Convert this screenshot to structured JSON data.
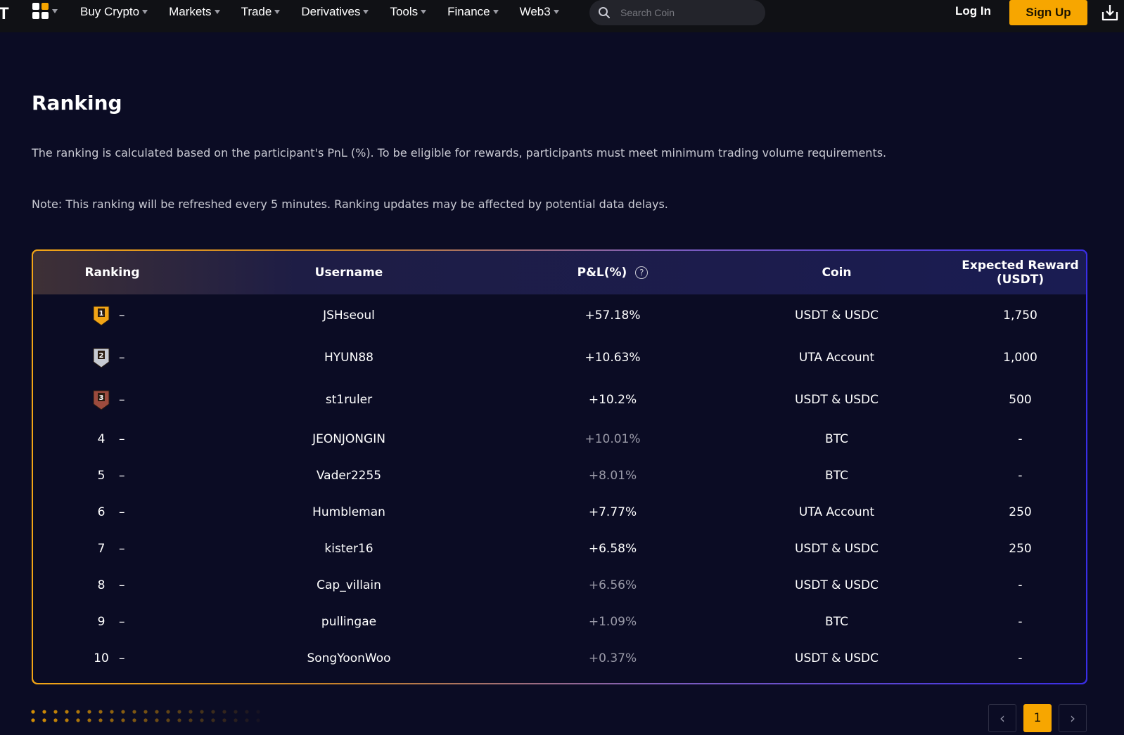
{
  "nav": {
    "logo_letter": "T",
    "items": [
      "Buy Crypto",
      "Markets",
      "Trade",
      "Derivatives",
      "Tools",
      "Finance",
      "Web3"
    ],
    "search_placeholder": "Search Coin",
    "login": "Log In",
    "signup": "Sign Up"
  },
  "page": {
    "title": "Ranking",
    "description": "The ranking is calculated based on the participant's PnL (%). To be eligible for rewards, participants must meet minimum trading volume requirements.",
    "note": "Note: This ranking will be refreshed every 5 minutes. Ranking updates may be affected by potential data delays."
  },
  "table": {
    "headers": {
      "ranking": "Ranking",
      "username": "Username",
      "pnl": "P&L(%)",
      "coin": "Coin",
      "reward": "Expected Reward (USDT)"
    },
    "rows": [
      {
        "rank": "1",
        "change": "–",
        "username": "JSHseoul",
        "pnl": "+57.18%",
        "coin": "USDT & USDC",
        "reward": "1,750"
      },
      {
        "rank": "2",
        "change": "–",
        "username": "HYUN88",
        "pnl": "+10.63%",
        "coin": "UTA Account",
        "reward": "1,000"
      },
      {
        "rank": "3",
        "change": "–",
        "username": "st1ruler",
        "pnl": "+10.2%",
        "coin": "USDT & USDC",
        "reward": "500"
      },
      {
        "rank": "4",
        "change": "–",
        "username": "JEONJONGIN",
        "pnl": "+10.01%",
        "coin": "BTC",
        "reward": "-"
      },
      {
        "rank": "5",
        "change": "–",
        "username": "Vader2255",
        "pnl": "+8.01%",
        "coin": "BTC",
        "reward": "-"
      },
      {
        "rank": "6",
        "change": "–",
        "username": "Humbleman",
        "pnl": "+7.77%",
        "coin": "UTA Account",
        "reward": "250"
      },
      {
        "rank": "7",
        "change": "–",
        "username": "kister16",
        "pnl": "+6.58%",
        "coin": "USDT & USDC",
        "reward": "250"
      },
      {
        "rank": "8",
        "change": "–",
        "username": "Cap_villain",
        "pnl": "+6.56%",
        "coin": "USDT & USDC",
        "reward": "-"
      },
      {
        "rank": "9",
        "change": "–",
        "username": "pullingae",
        "pnl": "+1.09%",
        "coin": "BTC",
        "reward": "-"
      },
      {
        "rank": "10",
        "change": "–",
        "username": "SongYoonWoo",
        "pnl": "+0.37%",
        "coin": "USDT & USDC",
        "reward": "-"
      }
    ]
  },
  "pagination": {
    "prev": "‹",
    "current": "1",
    "next": "›"
  },
  "colors": {
    "accent": "#f7a600",
    "background": "#0b0c24",
    "gold_medal": "#f2a516",
    "silver_medal": "#c7cbd3",
    "bronze_medal": "#9c4b3e"
  }
}
